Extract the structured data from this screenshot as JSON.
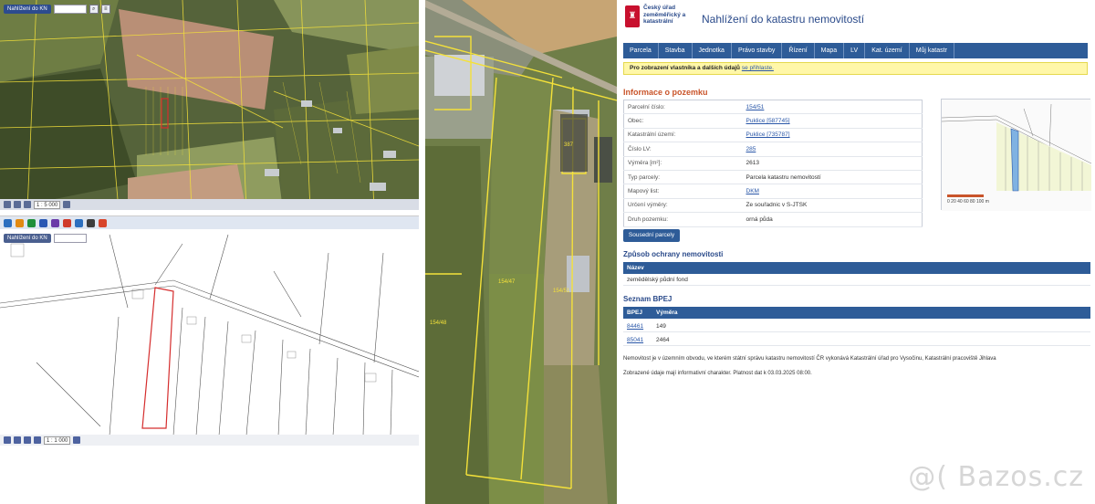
{
  "colors": {
    "nav_blue": "#2e5c98",
    "title_blue": "#2a4a8a",
    "section_orange": "#c9542a",
    "warning_yellow": "#fff7a8",
    "parcel_yellow": "#f4e13a",
    "parcel_red": "#d52d2d",
    "cuzk_red": "#c8102e"
  },
  "satellite_top": {
    "window_title": "Nahlížení do KN",
    "search_value": "",
    "zoom_value": "1 : 5 000"
  },
  "line_map": {
    "window_title": "Nahlížení do KN",
    "zoom_value": "1 : 1 000"
  },
  "satellite_mid": {
    "label_house": "387",
    "label_a": "154/47",
    "label_b": "154/51",
    "label_c": "154/48"
  },
  "cadastre": {
    "org_name": "Český úřad zeměměřický a katastrální",
    "page_title": "Nahlížení do katastru nemovitostí",
    "nav": [
      "Parcela",
      "Stavba",
      "Jednotka",
      "Právo stavby",
      "Řízení",
      "Mapa",
      "LV",
      "Kat. území",
      "Můj katastr"
    ],
    "warning_bold": "Pro zobrazení vlastníka a dalších údajů",
    "warning_rest": "se přihlaste.",
    "section_info": "Informace o pozemku",
    "info_rows": [
      {
        "label": "Parcelní číslo:",
        "value": "154/51",
        "link": true
      },
      {
        "label": "Obec:",
        "value": "Puklice [587745]",
        "link": true
      },
      {
        "label": "Katastrální území:",
        "value": "Puklice [735787]",
        "link": true
      },
      {
        "label": "Číslo LV:",
        "value": "285",
        "link": true
      },
      {
        "label": "Výměra [m²]:",
        "value": "2613",
        "link": false
      },
      {
        "label": "Typ parcely:",
        "value": "Parcela katastru nemovitostí",
        "link": false
      },
      {
        "label": "Mapový list:",
        "value": "DKM",
        "link": true
      },
      {
        "label": "Určení výměry:",
        "value": "Ze souřadnic v S-JTSK",
        "link": false
      },
      {
        "label": "Druh pozemku:",
        "value": "orná půda",
        "link": false
      }
    ],
    "neighbor_button": "Sousední parcely",
    "thumb_scale": "0  20  40  60  80 100 m",
    "section_protection": "Způsob ochrany nemovitosti",
    "protection_head": "Název",
    "protection_value": "zemědělský půdní fond",
    "section_bpej": "Seznam BPEJ",
    "bpej_head": [
      "BPEJ",
      "Výměra"
    ],
    "bpej_rows": [
      {
        "code": "84461",
        "area": "149"
      },
      {
        "code": "85041",
        "area": "2464"
      }
    ],
    "footer_1": "Nemovitost je v územním obvodu, ve kterém státní správu katastru nemovitostí ČR vykonává Katastrální úřad pro Vysočinu, Katastrální pracoviště Jihlava",
    "footer_2": "Zobrazené údaje mají informativní charakter. Platnost dat k 03.03.2025 08:00."
  },
  "watermark": "@( Bazos.cz"
}
